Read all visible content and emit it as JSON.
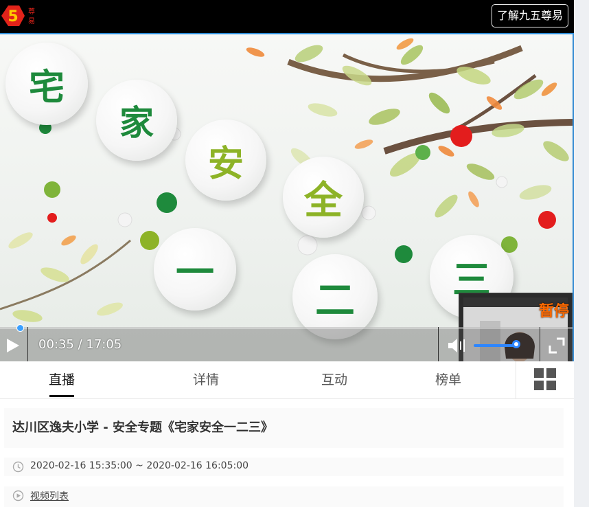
{
  "header": {
    "logo_text": "易",
    "about_label": "了解九五尊易"
  },
  "video": {
    "scene_chars": [
      "宅",
      "家",
      "安",
      "全",
      "一",
      "二",
      "三"
    ],
    "time_text": "00:35 / 17:05",
    "volume_level": 0.85,
    "pip_status": "暂停",
    "progress_fraction": 0.034
  },
  "tabs": [
    "直播",
    "详情",
    "互动",
    "榜单"
  ],
  "info": {
    "title": "达川区逸夫小学 - 安全专题《宅家安全一二三》",
    "time_range": "2020-02-16 15:35:00 ~ 2020-02-16 16:05:00",
    "video_list_label": "视频列表"
  },
  "colors": {
    "accent": "#2d86ff",
    "char_dark_green": "#1e8a3c",
    "char_lime": "#8db327",
    "pip_status": "#ff6a00"
  }
}
